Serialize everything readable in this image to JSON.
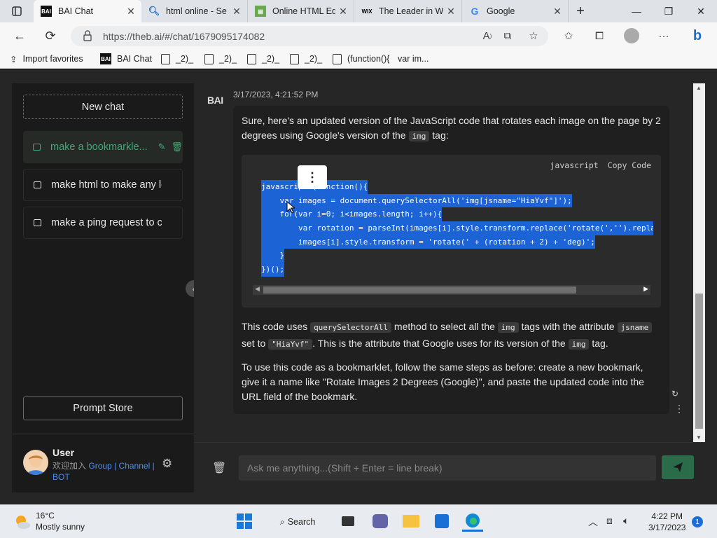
{
  "browser": {
    "tabs": [
      {
        "title": "BAI Chat",
        "favicon": "bai-icon"
      },
      {
        "title": "html online - Se",
        "favicon": "search-icon"
      },
      {
        "title": "Online HTML Ed",
        "favicon": "html-editor-icon"
      },
      {
        "title": "The Leader in W",
        "favicon": "wix-icon"
      },
      {
        "title": "Google",
        "favicon": "google-icon"
      }
    ],
    "url": "https://theb.ai/#/chat/1679095174082",
    "bookmarks": [
      "Import favorites",
      "BAI Chat",
      "_2)_",
      "_2)_",
      "_2)_",
      "_2)_",
      "(function(){",
      "var im..."
    ]
  },
  "sidebar": {
    "new_chat": "New chat",
    "chats": [
      {
        "label": "make a bookmarkle..."
      },
      {
        "label": "make html to make any let..."
      },
      {
        "label": "make a ping request to ch..."
      }
    ],
    "prompt_store": "Prompt Store",
    "user": {
      "name": "User",
      "join_text": "欢迎加入",
      "group": "Group",
      "sep": "|",
      "channel": "Channel",
      "bot": "BOT"
    }
  },
  "chat": {
    "bot_logo": "BAI",
    "timestamp": "3/17/2023, 4:21:52 PM",
    "intro_1": "Sure, here's an updated version of the JavaScript code that rotates each image on the page by 2 degrees using Google's version of the",
    "intro_code": "img",
    "intro_2": "tag:",
    "code_lang": "javascript",
    "copy_label": "Copy Code",
    "code_lines": [
      "javascript:(function(){",
      "    var images = document.querySelectorAll('img[jsname=\"HiaYvf\"]');",
      "    for(var i=0; i<images.length; i++){",
      "        var rotation = parseInt(images[i].style.transform.replace('rotate(','').repla",
      "        images[i].style.transform = 'rotate(' + (rotation + 2) + 'deg)';",
      "    }",
      "})();"
    ],
    "p2": {
      "a": "This code uses",
      "c1": "querySelectorAll",
      "b": "method to select all the",
      "c2": "img",
      "c": "tags with the attribute",
      "c3": "jsname",
      "d": "set to",
      "c4": "\"HiaYvf\"",
      "e": ". This is the attribute that Google uses for its version of the",
      "c5": "img",
      "f": "tag."
    },
    "p3": "To use this code as a bookmarklet, follow the same steps as before: create a new bookmark, give it a name like \"Rotate Images 2 Degrees (Google)\", and paste the updated code into the URL field of the bookmark.",
    "input_placeholder": "Ask me anything...(Shift + Enter = line break)"
  },
  "taskbar": {
    "temp": "16°C",
    "weather": "Mostly sunny",
    "search_label": "Search",
    "time": "4:22 PM",
    "date": "3/17/2023",
    "notifications": "1"
  },
  "colors": {
    "accent_green": "#3fa773",
    "link_blue": "#4a8fe7",
    "selection": "#1c63d6"
  }
}
